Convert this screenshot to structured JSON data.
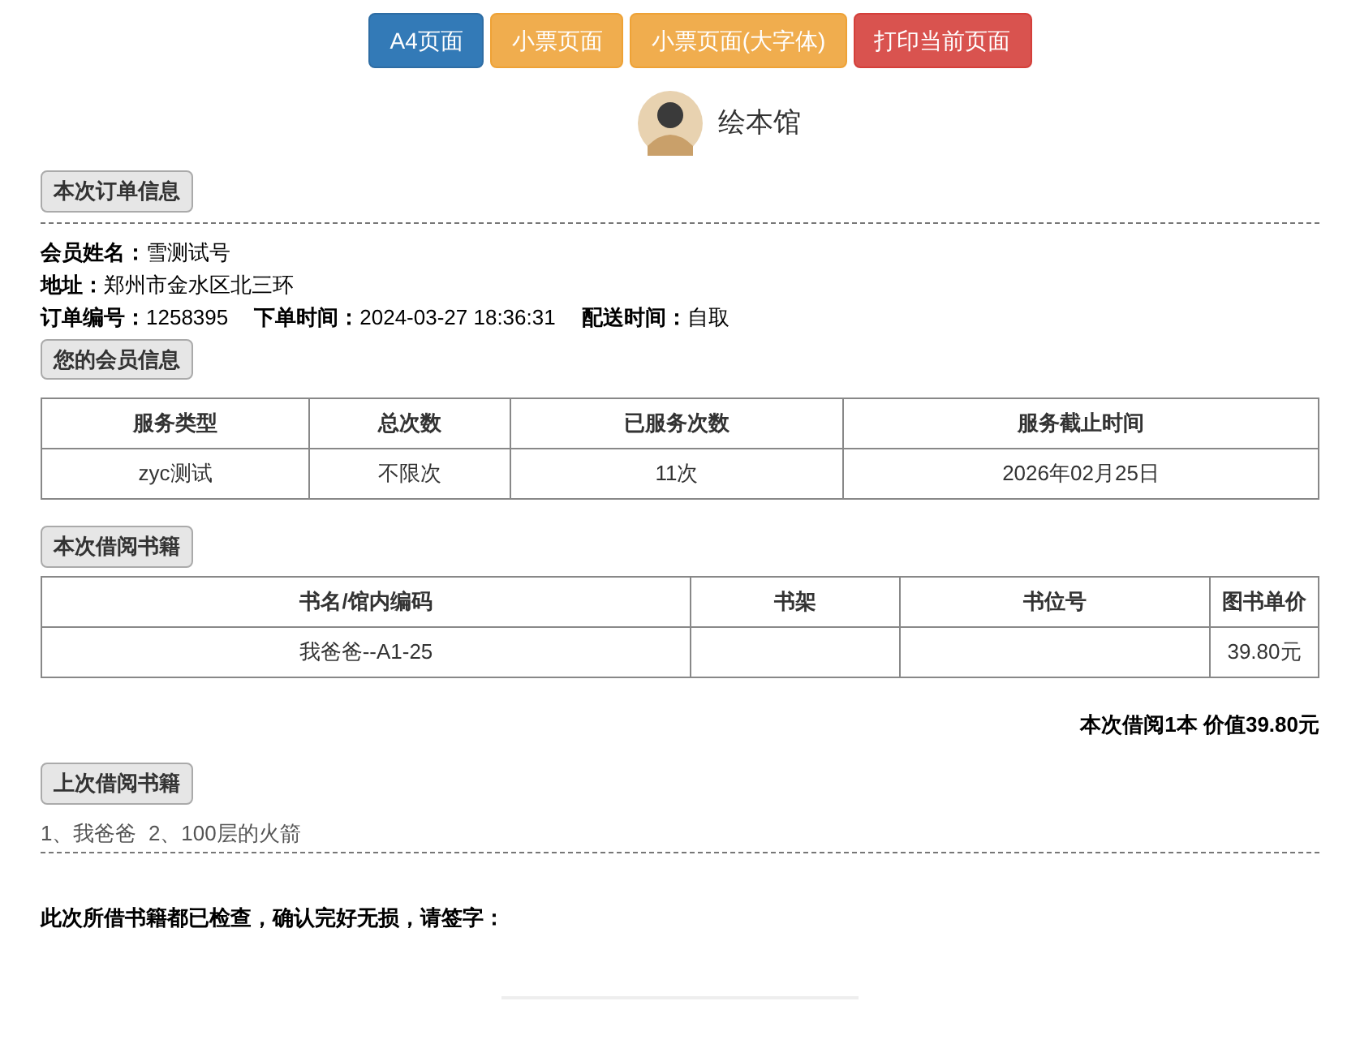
{
  "toolbar": [
    {
      "label": "A4页面",
      "kind": "primary"
    },
    {
      "label": "小票页面",
      "kind": "warning"
    },
    {
      "label": "小票页面(大字体)",
      "kind": "warning"
    },
    {
      "label": "打印当前页面",
      "kind": "danger"
    }
  ],
  "header": {
    "title": "绘本馆"
  },
  "order_section": {
    "heading": "本次订单信息",
    "fields": [
      [
        {
          "label": "会员姓名：",
          "value": "雪测试号"
        }
      ],
      [
        {
          "label": "地址：",
          "value": "郑州市金水区北三环"
        }
      ],
      [
        {
          "label": "订单编号：",
          "value": "1258395"
        },
        {
          "label": "下单时间：",
          "value": "2024-03-27 18:36:31"
        },
        {
          "label": "配送时间：",
          "value": "自取"
        }
      ]
    ]
  },
  "member_section": {
    "heading": "您的会员信息",
    "table": {
      "columns": [
        "服务类型",
        "总次数",
        "已服务次数",
        "服务截止时间"
      ],
      "rows": [
        [
          "zyc测试",
          "不限次",
          "11次",
          "2026年02月25日"
        ]
      ]
    }
  },
  "borrow_section": {
    "heading": "本次借阅书籍",
    "table": {
      "columns": [
        "书名/馆内编码",
        "书架",
        "书位号",
        "图书单价"
      ],
      "rows": [
        [
          "我爸爸--A1-25",
          "",
          "",
          "39.80元"
        ]
      ]
    },
    "summary": "本次借阅1本 价值39.80元"
  },
  "previous_section": {
    "heading": "上次借阅书籍",
    "text": "1、我爸爸  2、100层的火箭"
  },
  "signature": {
    "text": "此次所借书籍都已检查，确认完好无损，请签字："
  }
}
